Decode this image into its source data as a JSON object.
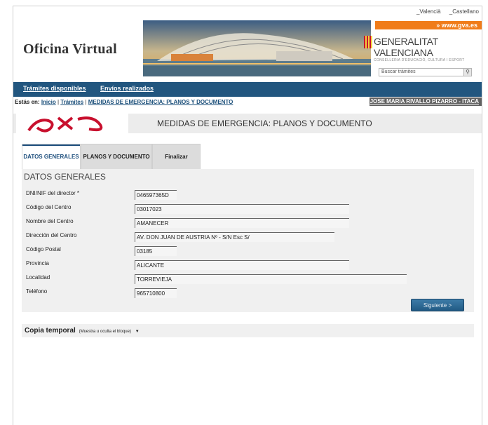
{
  "header": {
    "languages": [
      "_Valencià",
      "_Castellano"
    ],
    "logo_text": "Oficina Virtual",
    "gva_link": "» www.gva.es",
    "gv_name": "GENERALITAT VALENCIANA",
    "gv_sub": "CONSELLERIA D'EDUCACIÓ, CULTURA I ESPORT",
    "search_placeholder": "Buscar trámites"
  },
  "nav": {
    "items": [
      "Trámites disponibles",
      "Envíos realizados"
    ],
    "color": "#22567f"
  },
  "breadcrumb": {
    "prefix": "Estás en:",
    "inicio": "Inicio",
    "sep": "|",
    "tramites": "Trámites",
    "current": "MEDIDAS DE EMERGENCIA: PLANOS Y DOCUMENTO",
    "user": "JOSE MARIA RIVALLO PIZARRO - ITACA"
  },
  "page": {
    "title": "MEDIDAS DE EMERGENCIA: PLANOS Y DOCUMENTO"
  },
  "tabs": [
    {
      "label": "DATOS GENERALES"
    },
    {
      "label": "PLANOS Y DOCUMENTO"
    },
    {
      "label": "Finalizar"
    }
  ],
  "form": {
    "section_title": "DATOS GENERALES",
    "fields": [
      {
        "label": "DNI/NIF del director *",
        "value": "046597365D"
      },
      {
        "label": "Código del Centro",
        "value": "03017023"
      },
      {
        "label": "Nombre del Centro",
        "value": "AMANECER"
      },
      {
        "label": "Dirección del Centro",
        "value": "AV. DON JUAN DE AUSTRIA Nº - S/N Esc S/"
      },
      {
        "label": "Código Postal",
        "value": "03185"
      },
      {
        "label": "Provincia",
        "value": "ALICANTE"
      },
      {
        "label": "Localidad",
        "value": "TORREVIEJA"
      },
      {
        "label": "Teléfono",
        "value": "965710800"
      }
    ],
    "next_button": "Siguiente >"
  },
  "copy": {
    "title": "Copia temporal",
    "hint": "(Muestra u oculta el bloque)",
    "caret": "▼"
  }
}
